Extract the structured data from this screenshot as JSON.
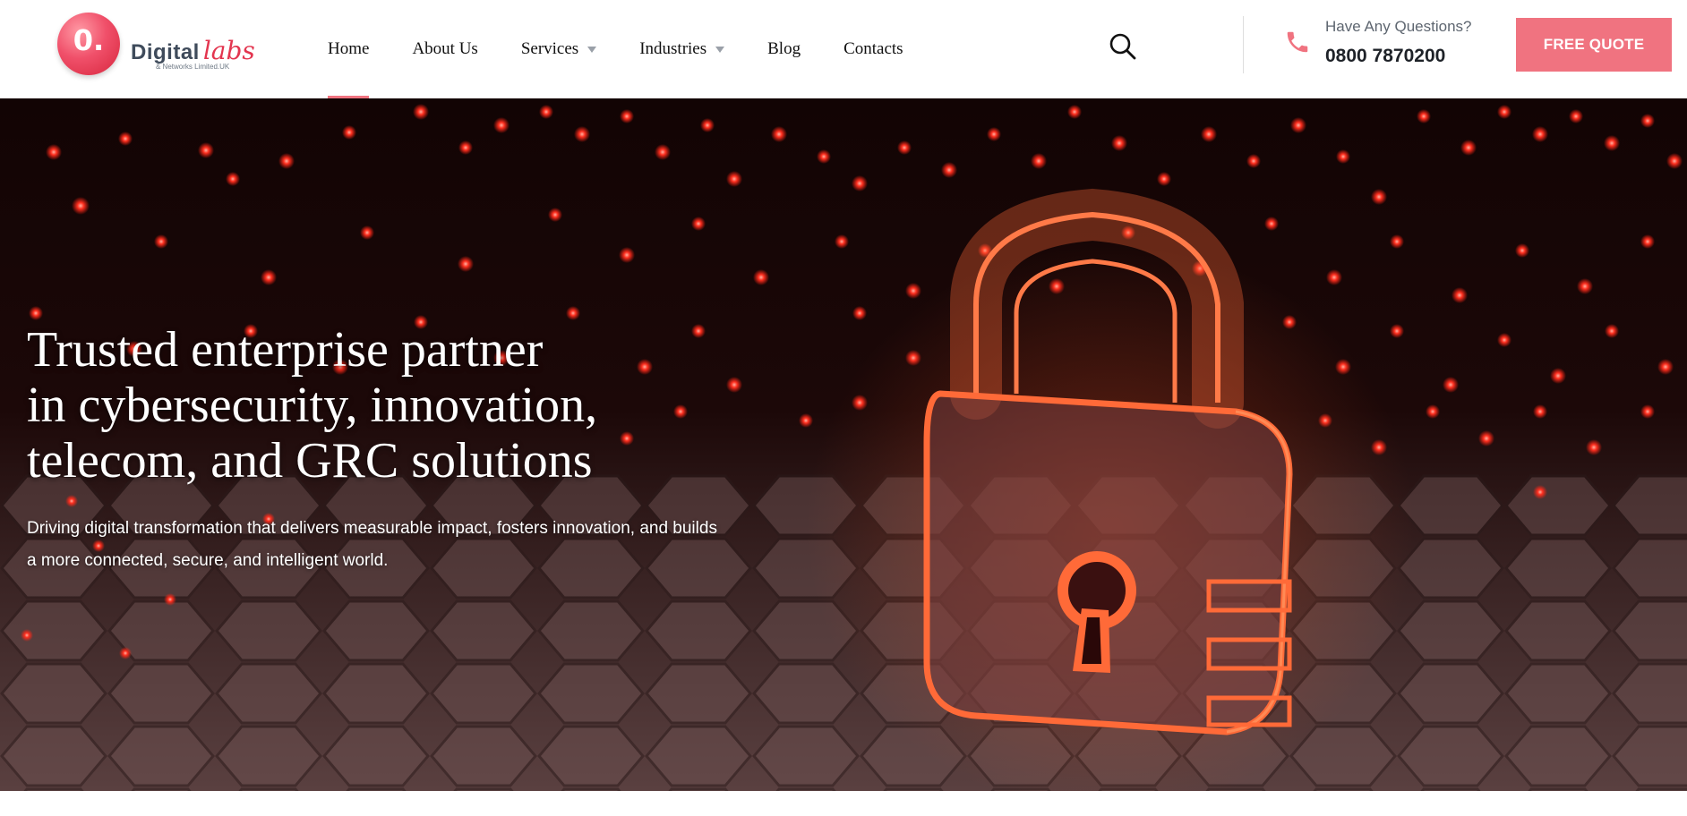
{
  "header": {
    "logo": {
      "mark": "0.",
      "word_digital": "Digital",
      "word_labs": "labs",
      "tagline": "& Networks Limited.UK"
    },
    "nav": [
      {
        "label": "Home",
        "active": true,
        "dropdown": false
      },
      {
        "label": "About Us",
        "active": false,
        "dropdown": false
      },
      {
        "label": "Services",
        "active": false,
        "dropdown": true
      },
      {
        "label": "Industries",
        "active": false,
        "dropdown": true
      },
      {
        "label": "Blog",
        "active": false,
        "dropdown": false
      },
      {
        "label": "Contacts",
        "active": false,
        "dropdown": false
      }
    ],
    "search_icon": "search-icon",
    "contact": {
      "icon": "phone-icon",
      "question": "Have Any Questions?",
      "phone": "0800 7870200"
    },
    "cta": "FREE QUOTE"
  },
  "hero": {
    "title_lines": [
      "Trusted enterprise partner",
      "in cybersecurity, innovation,",
      "telecom, and GRC solutions"
    ],
    "subtitle_lines": [
      "Driving digital transformation that delivers measurable impact, fosters innovation, and builds",
      "a more connected, secure, and intelligent world."
    ],
    "illustration": "padlock-icon"
  },
  "colors": {
    "accent": "#f07380",
    "brand_red": "#e3354f",
    "text_dark": "#111111",
    "hero_bg": "#0d0505"
  }
}
